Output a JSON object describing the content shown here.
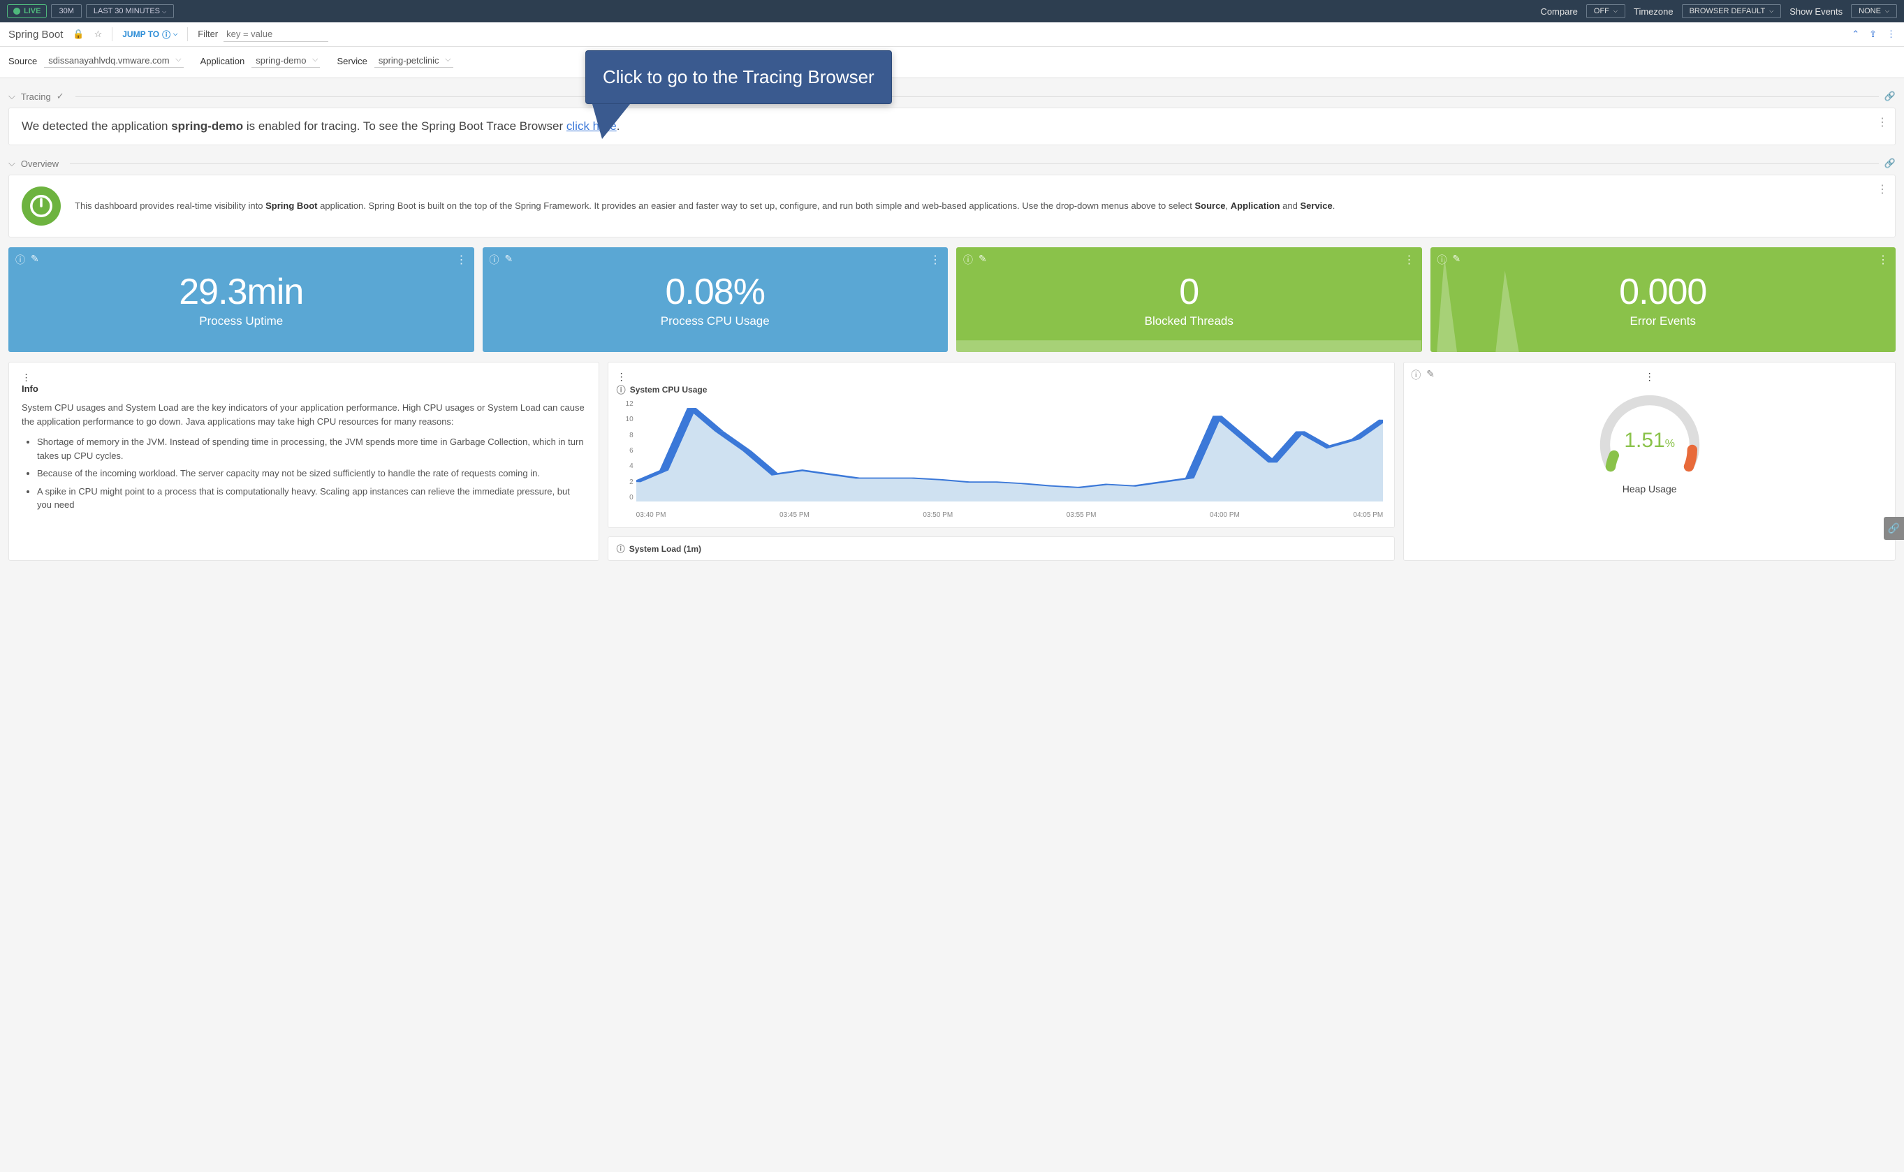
{
  "topbar": {
    "live": "LIVE",
    "t30m": "30M",
    "range": "LAST 30 MINUTES",
    "compare": "Compare",
    "compare_val": "OFF",
    "timezone": "Timezone",
    "timezone_val": "BROWSER DEFAULT",
    "show_events": "Show Events",
    "show_events_val": "NONE"
  },
  "subbar": {
    "title": "Spring Boot",
    "jump": "JUMP TO",
    "filter_label": "Filter",
    "filter_placeholder": "key = value"
  },
  "selectors": {
    "source_label": "Source",
    "source_val": "sdissanayahlvdq.vmware.com",
    "app_label": "Application",
    "app_val": "spring-demo",
    "svc_label": "Service",
    "svc_val": "spring-petclinic"
  },
  "sections": {
    "tracing": "Tracing",
    "overview": "Overview"
  },
  "tracing": {
    "t1": "We detected the application ",
    "t2": "spring-demo",
    "t3": " is enabled for tracing. To see the Spring Boot Trace Browser ",
    "link": "click here",
    "t4": "."
  },
  "overview": {
    "p1": "This dashboard provides real-time visibility into ",
    "b1": "Spring Boot",
    "p2": " application. Spring Boot is built on the top of the Spring Framework. It provides an easier and faster way to set up, configure, and run both simple and web-based applications. Use the drop-down menus above to select ",
    "b2": "Source",
    "comma1": ", ",
    "b3": "Application",
    "and": " and ",
    "b4": "Service",
    "dot": "."
  },
  "stats": [
    {
      "value": "29.3min",
      "label": "Process Uptime",
      "cls": "blue"
    },
    {
      "value": "0.08%",
      "label": "Process CPU Usage",
      "cls": "blue"
    },
    {
      "value": "0",
      "label": "Blocked Threads",
      "cls": "green"
    },
    {
      "value": "0.000",
      "label": "Error Events",
      "cls": "green"
    }
  ],
  "info": {
    "title": "Info",
    "para": "System CPU usages and System Load are the key indicators of your application performance. High CPU usages or System Load can cause the application performance to go down. Java applications may take high CPU resources for many reasons:",
    "bullets": [
      "Shortage of memory in the JVM. Instead of spending time in processing, the JVM spends more time in Garbage Collection, which in turn takes up CPU cycles.",
      "Because of the incoming workload. The server capacity may not be sized sufficiently to handle the rate of requests coming in.",
      "A spike in CPU might point to a process that is computationally heavy. Scaling app instances can relieve the immediate pressure, but you need"
    ]
  },
  "cpu_chart": {
    "title": "System CPU Usage",
    "yticks": [
      "12",
      "10",
      "8",
      "6",
      "4",
      "2",
      "0"
    ],
    "xticks": [
      "03:40 PM",
      "03:45 PM",
      "03:50 PM",
      "03:55 PM",
      "04:00 PM",
      "04:05 PM"
    ]
  },
  "gauge": {
    "value": "1.51",
    "pct": "%",
    "label": "Heap Usage"
  },
  "load_chart": {
    "title": "System Load (1m)"
  },
  "callout": "Click to go to the Tracing Browser",
  "chart_data": {
    "type": "line",
    "title": "System CPU Usage",
    "xlabel": "",
    "ylabel": "",
    "ylim": [
      0,
      13
    ],
    "x": [
      "03:40 PM",
      "03:41 PM",
      "03:42 PM",
      "03:43 PM",
      "03:44 PM",
      "03:45 PM",
      "03:46 PM",
      "03:47 PM",
      "03:48 PM",
      "03:49 PM",
      "03:50 PM",
      "03:51 PM",
      "03:52 PM",
      "03:53 PM",
      "03:54 PM",
      "03:55 PM",
      "03:56 PM",
      "03:57 PM",
      "03:58 PM",
      "03:59 PM",
      "04:00 PM",
      "04:01 PM",
      "04:02 PM",
      "04:03 PM",
      "04:04 PM",
      "04:05 PM",
      "04:06 PM",
      "04:07 PM"
    ],
    "values": [
      2.5,
      4,
      12,
      9,
      6.5,
      3.5,
      4,
      3.5,
      3,
      3,
      3,
      2.8,
      2.5,
      2.5,
      2.3,
      2,
      1.8,
      2.2,
      2,
      2.5,
      3,
      11,
      8,
      5,
      9,
      7,
      8,
      10.5
    ]
  }
}
